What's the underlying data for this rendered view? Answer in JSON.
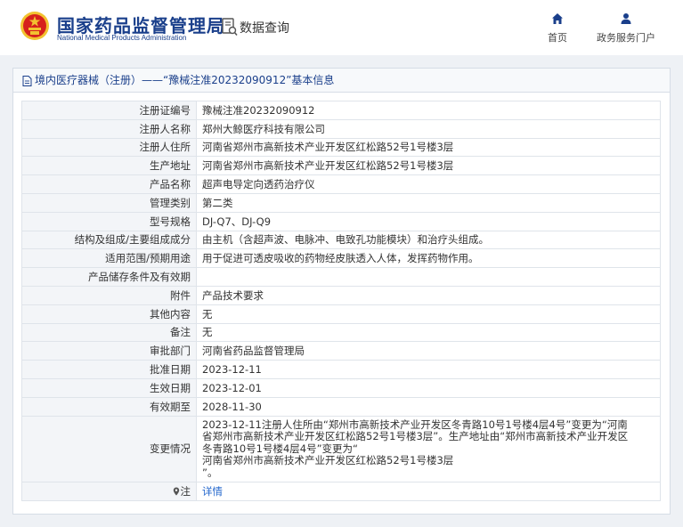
{
  "header": {
    "title": "国家药品监督管理局",
    "subtitle": "National Medical Products Administration",
    "query_label": "数据查询",
    "nav": [
      {
        "label": "首页",
        "icon": "home-icon"
      },
      {
        "label": "政务服务门户",
        "icon": "user-icon"
      }
    ]
  },
  "panel": {
    "heading": "境内医疗器械（注册）——“豫械注准20232090912”基本信息"
  },
  "rows": [
    {
      "label": "注册证编号",
      "value": "豫械注准20232090912"
    },
    {
      "label": "注册人名称",
      "value": "郑州大鲸医疗科技有限公司"
    },
    {
      "label": "注册人住所",
      "value": "河南省郑州市高新技术产业开发区红松路52号1号楼3层"
    },
    {
      "label": "生产地址",
      "value": "河南省郑州市高新技术产业开发区红松路52号1号楼3层"
    },
    {
      "label": "产品名称",
      "value": "超声电导定向透药治疗仪"
    },
    {
      "label": "管理类别",
      "value": "第二类"
    },
    {
      "label": "型号规格",
      "value": "DJ-Q7、DJ-Q9"
    },
    {
      "label": "结构及组成/主要组成成分",
      "value": "由主机（含超声波、电脉冲、电致孔功能模块）和治疗头组成。"
    },
    {
      "label": "适用范围/预期用途",
      "value": "用于促进可透皮吸收的药物经皮肤透入人体，发挥药物作用。"
    },
    {
      "label": "产品储存条件及有效期",
      "value": ""
    },
    {
      "label": "附件",
      "value": "产品技术要求"
    },
    {
      "label": "其他内容",
      "value": "无"
    },
    {
      "label": "备注",
      "value": "无"
    },
    {
      "label": "审批部门",
      "value": "河南省药品监督管理局"
    },
    {
      "label": "批准日期",
      "value": "2023-12-11"
    },
    {
      "label": "生效日期",
      "value": "2023-12-01"
    },
    {
      "label": "有效期至",
      "value": "2028-11-30"
    }
  ],
  "change": {
    "label": "变更情况",
    "lines": [
      "2023-12-11注册人住所由“郑州市高新技术产业开发区冬青路10号1号楼4层4号”变更为“河南",
      "省郑州市高新技术产业开发区红松路52号1号楼3层”。生产地址由“郑州市高新技术产业开发区",
      "冬青路10号1号楼4层4号”变更为“",
      "河南省郑州市高新技术产业开发区红松路52号1号楼3层",
      "”。"
    ]
  },
  "note": {
    "label": "注",
    "link": "详情"
  },
  "colors": {
    "brand": "#1a3f8b",
    "link": "#2266cc",
    "emblem_red": "#d6211c",
    "emblem_gold": "#f2c230"
  }
}
